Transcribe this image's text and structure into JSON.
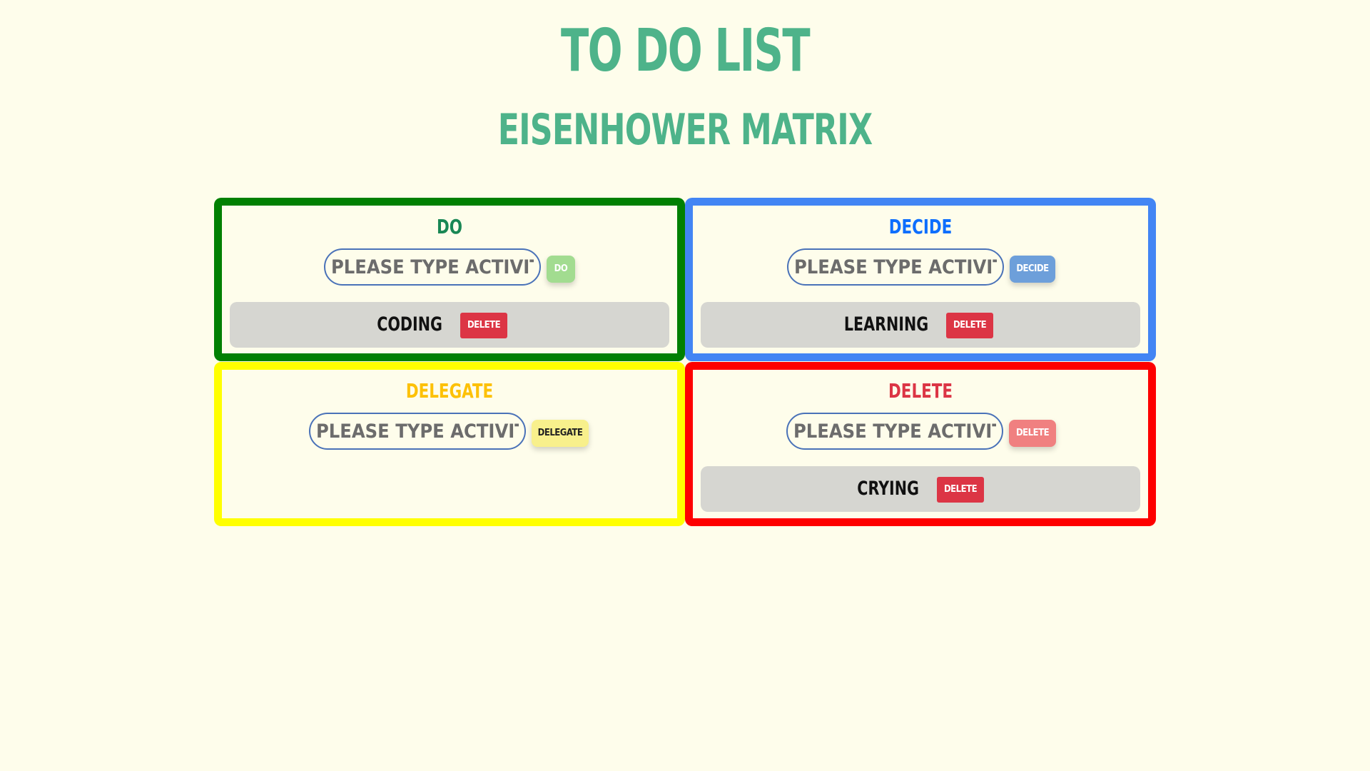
{
  "header": {
    "title": "TO DO LIST",
    "subtitle": "EISENHOWER MATRIX"
  },
  "quadrants": {
    "do": {
      "title": "DO",
      "input_placeholder": "PLEASE TYPE ACTIVITY.",
      "add_label": "DO",
      "tasks": [
        {
          "label": "CODING",
          "delete_label": "DELETE"
        }
      ]
    },
    "decide": {
      "title": "DECIDE",
      "input_placeholder": "PLEASE TYPE ACTIVITY.",
      "add_label": "DECIDE",
      "tasks": [
        {
          "label": "LEARNING",
          "delete_label": "DELETE"
        }
      ]
    },
    "delegate": {
      "title": "DELEGATE",
      "input_placeholder": "PLEASE TYPE ACTIVITY.",
      "add_label": "DELEGATE",
      "tasks": []
    },
    "delete": {
      "title": "DELETE",
      "input_placeholder": "PLEASE TYPE ACTIVITY.",
      "add_label": "DELETE",
      "tasks": [
        {
          "label": "CRYING",
          "delete_label": "DELETE"
        }
      ]
    }
  },
  "colors": {
    "background": "#fefdeb",
    "heading": "#4eb38a",
    "do_border": "#018002",
    "decide_border": "#4285f4",
    "delegate_border": "#ffff00",
    "delete_border": "#fe0000",
    "delete_button": "#dc3545"
  }
}
